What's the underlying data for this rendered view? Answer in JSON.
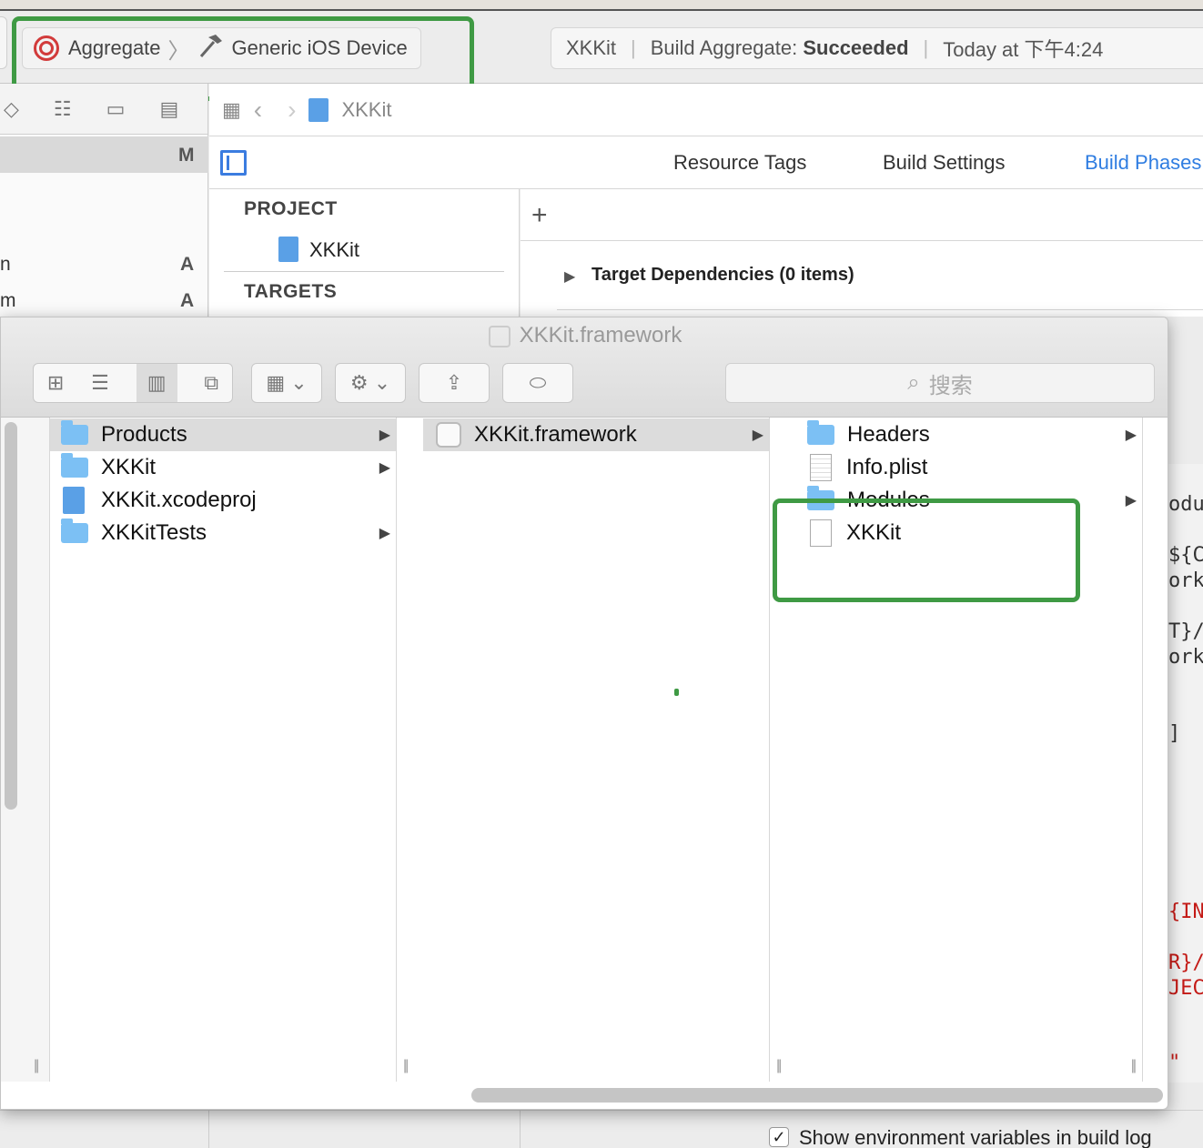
{
  "toolbar": {
    "scheme_target": "Aggregate",
    "scheme_destination": "Generic iOS Device",
    "activity_project": "XKKit",
    "activity_status_prefix": "Build Aggregate:",
    "activity_status": "Succeeded",
    "activity_time": "Today at 下午4:24"
  },
  "navigator": {
    "selected_badge": "M",
    "row_items": [
      {
        "text": "n",
        "badge": "A"
      },
      {
        "text": "m",
        "badge": "A"
      }
    ]
  },
  "jumpbar": {
    "item": "XKKit"
  },
  "editor_tabs": [
    "Resource Tags",
    "Build Settings",
    "Build Phases"
  ],
  "project_panel": {
    "project_header": "PROJECT",
    "project_item": "XKKit",
    "targets_header": "TARGETS"
  },
  "phases": {
    "add_symbol": "+",
    "target_dependencies": "Target Dependencies (0 items)"
  },
  "finder": {
    "title": "XKKit.framework",
    "search_placeholder": "搜索",
    "column1": [
      {
        "name": "Products",
        "type": "folder",
        "selected": true
      },
      {
        "name": "XKKit",
        "type": "folder"
      },
      {
        "name": "XKKit.xcodeproj",
        "type": "xcodeproj"
      },
      {
        "name": "XKKitTests",
        "type": "folder"
      }
    ],
    "column2": [
      {
        "name": "XKKit.framework",
        "type": "framework",
        "selected": true
      }
    ],
    "column3": [
      {
        "name": "Headers",
        "type": "folder"
      },
      {
        "name": "Info.plist",
        "type": "plist"
      },
      {
        "name": "Modules",
        "type": "folder"
      },
      {
        "name": "XKKit",
        "type": "file"
      }
    ]
  },
  "code_fragment": [
    "odu",
    "${C",
    "ork",
    "T}/",
    "ork",
    "]",
    "{IN",
    "R}/",
    "JEC",
    "\""
  ],
  "bottom": {
    "checkbox_label": "Show environment variables in build log",
    "checkbox_checked": true
  },
  "annotation_color": "#3f9a44"
}
